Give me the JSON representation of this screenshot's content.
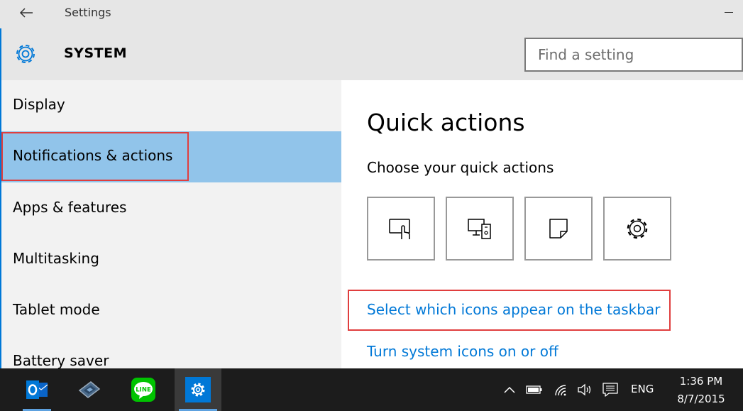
{
  "window": {
    "title": "Settings"
  },
  "header": {
    "title": "SYSTEM",
    "search_placeholder": "Find a setting"
  },
  "sidebar": {
    "items": [
      {
        "label": "Display"
      },
      {
        "label": "Notifications & actions"
      },
      {
        "label": "Apps & features"
      },
      {
        "label": "Multitasking"
      },
      {
        "label": "Tablet mode"
      },
      {
        "label": "Battery saver"
      }
    ],
    "selected": "Notifications & actions"
  },
  "content": {
    "title": "Quick actions",
    "subtitle": "Choose your quick actions",
    "quick_actions": [
      {
        "icon": "tablet-mode-icon"
      },
      {
        "icon": "connect-icon"
      },
      {
        "icon": "note-icon"
      },
      {
        "icon": "settings-gear-icon"
      }
    ],
    "links": {
      "select_icons": "Select which icons appear on the taskbar",
      "system_icons": "Turn system icons on or off"
    }
  },
  "taskbar": {
    "apps": [
      {
        "icon": "outlook-icon"
      },
      {
        "icon": "app-icon"
      },
      {
        "icon": "line-icon",
        "text": "LINE"
      },
      {
        "icon": "settings-icon"
      }
    ],
    "language": "ENG",
    "time": "1:36 PM",
    "date": "8/7/2015"
  },
  "colors": {
    "accent": "#0078d7",
    "selected_bg": "#91c4ea",
    "highlight_box": "#e03e3e",
    "line_green": "#00c300"
  }
}
